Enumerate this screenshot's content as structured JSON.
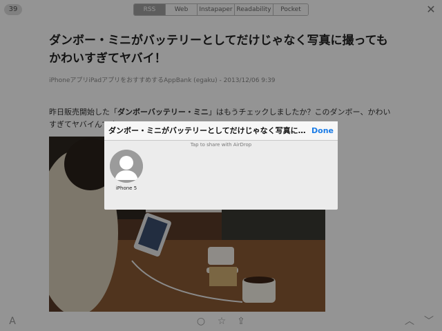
{
  "topbar": {
    "unread_count": "39",
    "tabs": [
      {
        "label": "RSS",
        "active": true
      },
      {
        "label": "Web",
        "active": false
      },
      {
        "label": "Instapaper",
        "active": false
      },
      {
        "label": "Readability",
        "active": false
      },
      {
        "label": "Pocket",
        "active": false
      }
    ],
    "close_icon": "close-icon"
  },
  "article": {
    "title": "ダンボー・ミニがバッテリーとしてだけじゃなく写真に撮ってもかわいすぎてヤバイ！",
    "meta": "iPhoneアプリiPadアプリをおすすめするAppBank (egaku) - 2013/12/06 9:39",
    "body_prefix": "昨日販売開始した「",
    "body_bold": "ダンボーバッテリー・ミニ",
    "body_suffix": "」はもうチェックしましたか？このダンボー、かわいすぎてヤバイんです。"
  },
  "share_sheet": {
    "title": "ダンボー・ミニがバッテリーとしてだけじゃなく写真に撮ってもかわいすぎてヤバイ！",
    "done_label": "Done",
    "airdrop_hint": "Tap to share with AirDrop",
    "devices": [
      {
        "label": "iPhone 5"
      }
    ]
  },
  "bottombar": {
    "icons": [
      "font-size-icon",
      "circle-icon",
      "star-icon",
      "share-icon",
      "up-chevron-icon",
      "down-chevron-icon"
    ]
  },
  "colors": {
    "accent": "#1a7be6",
    "overlay": "#000000"
  }
}
